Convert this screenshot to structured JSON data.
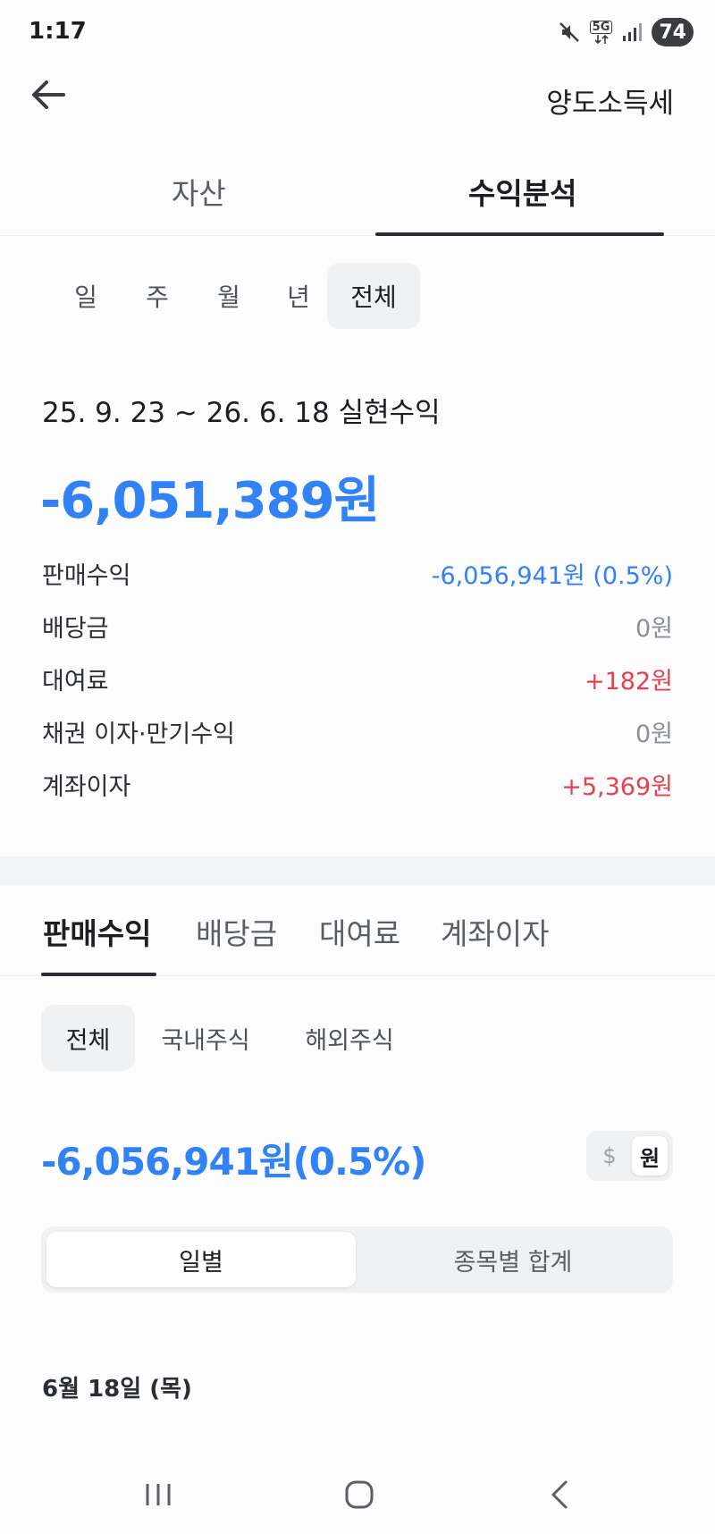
{
  "status_bar": {
    "time": "1:17",
    "network_label": "5G",
    "battery": "74",
    "icons": [
      "mute-icon",
      "5g-network-icon",
      "signal-icon",
      "battery-icon"
    ]
  },
  "header": {
    "back_icon": "arrow-left-icon",
    "link_label": "양도소득세"
  },
  "main_tabs": [
    {
      "label": "자산",
      "active": false
    },
    {
      "label": "수익분석",
      "active": true
    }
  ],
  "period_filters": [
    {
      "label": "일",
      "active": false
    },
    {
      "label": "주",
      "active": false
    },
    {
      "label": "월",
      "active": false
    },
    {
      "label": "년",
      "active": false
    },
    {
      "label": "전체",
      "active": true
    }
  ],
  "summary": {
    "range_title": "25. 9. 23 ~ 26. 6. 18 실현수익",
    "total_amount": "-6,051,389원"
  },
  "breakdown": [
    {
      "label": "판매수익",
      "value": "-6,056,941원 (0.5%)",
      "tone": "blue"
    },
    {
      "label": "배당금",
      "value": "0원",
      "tone": "gray"
    },
    {
      "label": "대여료",
      "value": "+182원",
      "tone": "red"
    },
    {
      "label": "채권 이자·만기수익",
      "value": "0원",
      "tone": "gray"
    },
    {
      "label": "계좌이자",
      "value": "+5,369원",
      "tone": "red"
    }
  ],
  "detail_tabs": [
    {
      "label": "판매수익",
      "active": true
    },
    {
      "label": "배당금",
      "active": false
    },
    {
      "label": "대여료",
      "active": false
    },
    {
      "label": "계좌이자",
      "active": false
    }
  ],
  "market_filters": [
    {
      "label": "전체",
      "active": true
    },
    {
      "label": "국내주식",
      "active": false
    },
    {
      "label": "해외주식",
      "active": false
    }
  ],
  "sale_profit": {
    "amount": "-6,056,941원(0.5%)"
  },
  "currency_toggle": {
    "options": [
      "$",
      "원"
    ],
    "selected": "원"
  },
  "view_mode": {
    "options": [
      "일별",
      "종목별 합계"
    ],
    "selected": "일별"
  },
  "list": {
    "date_header": "6월 18일 (목)"
  },
  "nav_bar": {
    "icons": [
      "recent-apps-icon",
      "home-icon",
      "back-icon"
    ]
  },
  "colors": {
    "negative_blue": "#3182f6",
    "positive_red": "#e5404d",
    "text_primary": "#1c1e21",
    "chip_bg": "#eff1f3"
  }
}
